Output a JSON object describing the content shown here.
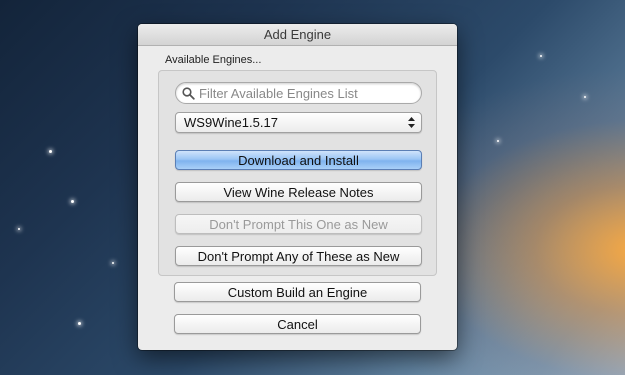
{
  "dialog": {
    "title": "Add Engine",
    "group_label": "Available Engines...",
    "search": {
      "placeholder": "Filter Available Engines List",
      "value": ""
    },
    "engine_select": {
      "selected": "WS9Wine1.5.17"
    },
    "buttons": {
      "download_install": "Download and Install",
      "view_release_notes": "View Wine Release Notes",
      "dont_prompt_this": "Don't Prompt This One as New",
      "dont_prompt_any": "Don't Prompt Any of These as New",
      "custom_build": "Custom Build an Engine",
      "cancel": "Cancel"
    }
  },
  "icons": {
    "search": "search-icon",
    "popup_arrows": "updown-arrows-icon"
  },
  "colors": {
    "default_button": "#9cc6f5",
    "dialog_bg": "#ececec"
  }
}
